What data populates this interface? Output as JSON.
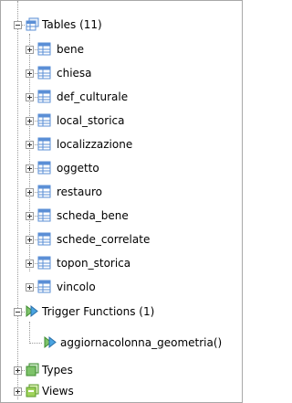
{
  "tables_group": {
    "label": "Tables (11)",
    "icon": "tables-icon",
    "expanded": true
  },
  "tables": [
    {
      "label": "bene",
      "icon": "table-icon"
    },
    {
      "label": "chiesa",
      "icon": "table-icon"
    },
    {
      "label": "def_culturale",
      "icon": "table-icon"
    },
    {
      "label": "local_storica",
      "icon": "table-icon"
    },
    {
      "label": "localizzazione",
      "icon": "table-icon"
    },
    {
      "label": "oggetto",
      "icon": "table-icon"
    },
    {
      "label": "restauro",
      "icon": "table-icon"
    },
    {
      "label": "scheda_bene",
      "icon": "table-icon"
    },
    {
      "label": "schede_correlate",
      "icon": "table-icon"
    },
    {
      "label": "topon_storica",
      "icon": "table-icon"
    },
    {
      "label": "vincolo",
      "icon": "table-icon"
    }
  ],
  "trigger_group": {
    "label": "Trigger Functions (1)",
    "icon": "trigger-functions-icon",
    "expanded": true
  },
  "trigger_functions": [
    {
      "label": "aggiornacolonna_geometria()",
      "icon": "trigger-function-icon"
    }
  ],
  "types_group": {
    "label": "Types",
    "icon": "types-icon",
    "expanded": false
  },
  "views_group": {
    "label": "Views",
    "icon": "views-icon",
    "expanded": false
  },
  "colors": {
    "table_blue": "#5b8fd6",
    "green": "#4caf50",
    "lines": "#9a9a9a"
  }
}
